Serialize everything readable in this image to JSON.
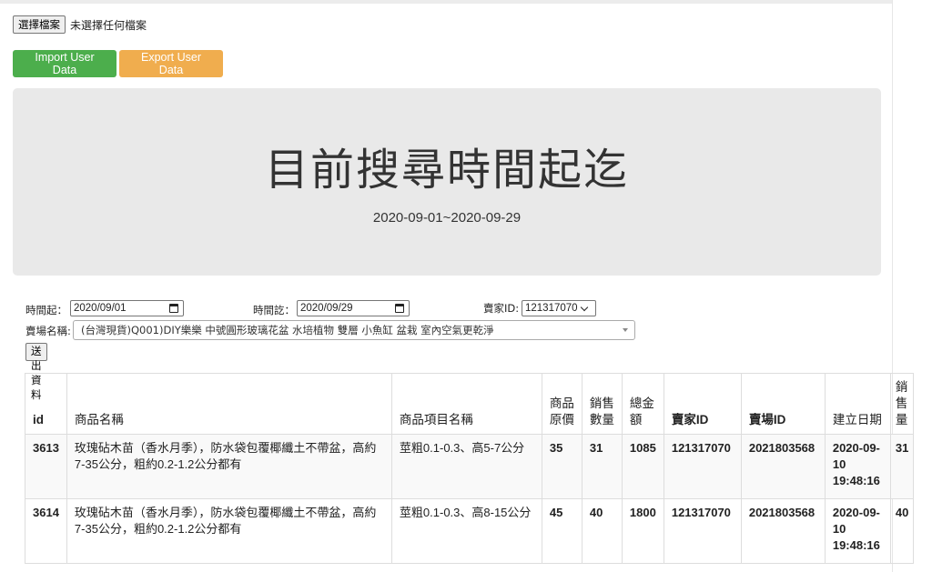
{
  "file_input": {
    "button_label": "選擇檔案",
    "status": "未選擇任何檔案"
  },
  "actions": {
    "import_label": "Import User Data",
    "export_label": "Export User Data"
  },
  "jumbotron": {
    "title": "目前搜尋時間起迄",
    "range": "2020-09-01~2020-09-29"
  },
  "form": {
    "start_label": "時間起：",
    "start_value": "2020/09/01",
    "end_label": "時間訖：",
    "end_value": "2020/09/29",
    "seller_label": "賣家ID:",
    "seller_value": "121317070",
    "store_label": "賣場名稱:",
    "store_value": "(台灣現貨)Q001)DIY樂樂 中號圓形玻璃花盆 水培植物 雙層 小魚缸 盆栽 室內空氣更乾淨",
    "submit_label": "送出資料"
  },
  "table": {
    "headers": {
      "id": "id",
      "name": "商品名稱",
      "item": "商品項目名稱",
      "price": "商品原價",
      "qty": "銷售數量",
      "total": "總金額",
      "seller": "賣家ID",
      "store": "賣場ID",
      "created": "建立日期",
      "sales": "銷售量"
    },
    "rows": [
      {
        "id": "3613",
        "name": "玫瑰砧木苗（香水月季），防水袋包覆椰纖土不帶盆，高約7-35公分，粗約0.2-1.2公分都有",
        "item": "莖粗0.1-0.3、高5-7公分",
        "price": "35",
        "qty": "31",
        "total": "1085",
        "seller": "121317070",
        "store": "2021803568",
        "created": "2020-09-10 19:48:16",
        "sales": "31"
      },
      {
        "id": "3614",
        "name": "玫瑰砧木苗（香水月季），防水袋包覆椰纖土不帶盆，高約7-35公分，粗約0.2-1.2公分都有",
        "item": "莖粗0.1-0.3、高8-15公分",
        "price": "45",
        "qty": "40",
        "total": "1800",
        "seller": "121317070",
        "store": "2021803568",
        "created": "2020-09-10 19:48:16",
        "sales": "40"
      }
    ]
  }
}
